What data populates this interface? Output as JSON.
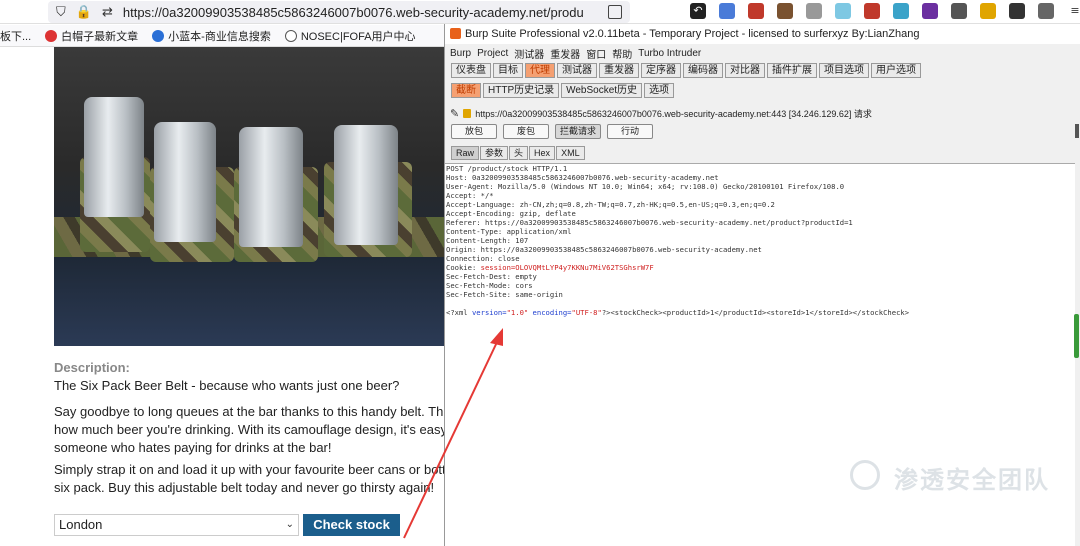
{
  "browser": {
    "url": "https://0a32009903538485c5863246007b0076.web-security-academy.net/product?productI",
    "bookmarks": [
      "板下...",
      "白帽子最新文章",
      "小蓝本-商业信息搜索",
      "NOSEC|FOFA用户中心"
    ]
  },
  "product": {
    "description_heading": "Description:",
    "lines": [
      "The Six Pack Beer Belt - because who wants just one beer?",
      "Say goodbye to long queues at the bar thanks to this handy belt. This be",
      "how much beer you're drinking. With its camouflage design, it's easy to s",
      "someone who hates paying for drinks at the bar!",
      "Simply strap it on and load it up with your favourite beer cans or bottles",
      "six pack. Buy this adjustable belt today and never go thirsty again!"
    ],
    "store_selected": "London",
    "check_stock_label": "Check stock"
  },
  "burp": {
    "title": "Burp Suite Professional v2.0.11beta - Temporary Project - licensed to surferxyz By:LianZhang",
    "menu": [
      "Burp",
      "Project",
      "测试器",
      "重发器",
      "窗口",
      "帮助",
      "Turbo Intruder"
    ],
    "main_tabs": [
      "仪表盘",
      "目标",
      "代理",
      "测试器",
      "重发器",
      "定序器",
      "编码器",
      "对比器",
      "插件扩展",
      "项目选项",
      "用户选项"
    ],
    "active_main_tab": "代理",
    "sub_tabs": [
      "截断",
      "HTTP历史记录",
      "WebSocket历史",
      "选项"
    ],
    "active_sub_tab": "截断",
    "request_target": "https://0a32009903538485c5863246007b0076.web-security-academy.net:443  [34.246.129.62] 请求",
    "action_buttons": [
      "放包",
      "废包",
      "拦截请求",
      "行动"
    ],
    "active_action": "拦截请求",
    "view_tabs": [
      "Raw",
      "参数",
      "头",
      "Hex",
      "XML"
    ],
    "active_view_tab": "Raw",
    "request_lines": [
      "POST /product/stock HTTP/1.1",
      "Host: 0a32009903538485c5863246007b0076.web-security-academy.net",
      "User-Agent: Mozilla/5.0 (Windows NT 10.0; Win64; x64; rv:108.0) Gecko/20100101 Firefox/108.0",
      "Accept: */*",
      "Accept-Language: zh-CN,zh;q=0.8,zh-TW;q=0.7,zh-HK;q=0.5,en-US;q=0.3,en;q=0.2",
      "Accept-Encoding: gzip, deflate",
      "Referer: https://0a32009903538485c5863246007b0076.web-security-academy.net/product?productId=1",
      "Content-Type: application/xml",
      "Content-Length: 107",
      "Origin: https://0a32009903538485c5863246007b0076.web-security-academy.net",
      "Connection: close"
    ],
    "cookie_key": "Cookie: ",
    "cookie_value": "session=OLOVQMtLYP4y7KKNu7MiV62TSGhsrW7F",
    "request_lines2": [
      "Sec-Fetch-Dest: empty",
      "Sec-Fetch-Mode: cors",
      "Sec-Fetch-Site: same-origin"
    ],
    "xml_a": "<?xml ",
    "xml_b": "version=",
    "xml_c": "\"1.0\"",
    "xml_d": " encoding=",
    "xml_e": "\"UTF-8\"",
    "xml_f": "?><stockCheck><productId>1</productId><storeId>1</storeId></stockCheck>"
  },
  "watermark": "渗透安全团队",
  "colors": {
    "burp_accent": "#f5a072",
    "check_button": "#1b5e8c",
    "arrow": "#e53935"
  }
}
